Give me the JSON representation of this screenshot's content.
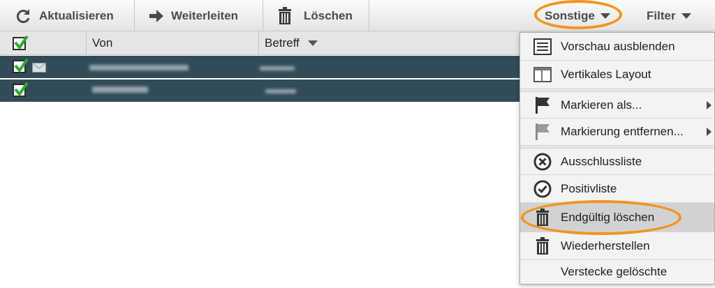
{
  "toolbar": {
    "refresh_label": "Aktualisieren",
    "forward_label": "Weiterleiten",
    "delete_label": "Löschen",
    "other_label": "Sonstige",
    "filter_label": "Filter"
  },
  "grid": {
    "columns": [
      "Von",
      "Betreff"
    ],
    "rows": [
      {
        "checked": true,
        "has_mail_icon": true
      },
      {
        "checked": true,
        "has_mail_icon": false
      }
    ]
  },
  "menu": {
    "items": [
      {
        "label": "Vorschau ausblenden",
        "icon": "preview-icon"
      },
      {
        "label": "Vertikales Layout",
        "icon": "layout-icon"
      },
      {
        "label": "Markieren als...",
        "icon": "flag-dark-icon",
        "submenu": true
      },
      {
        "label": "Markierung entfernen...",
        "icon": "flag-light-icon",
        "submenu": true
      },
      {
        "label": "Ausschlussliste",
        "icon": "x-circle-icon"
      },
      {
        "label": "Positivliste",
        "icon": "check-circle-icon"
      },
      {
        "label": "Endgültig löschen",
        "icon": "trash-icon",
        "selected": true
      },
      {
        "label": "Wiederherstellen",
        "icon": "trash-icon"
      },
      {
        "label": "Verstecke gelöschte",
        "icon": ""
      }
    ]
  },
  "colors": {
    "row_selected": "#324c57",
    "highlight": "#f39320"
  }
}
